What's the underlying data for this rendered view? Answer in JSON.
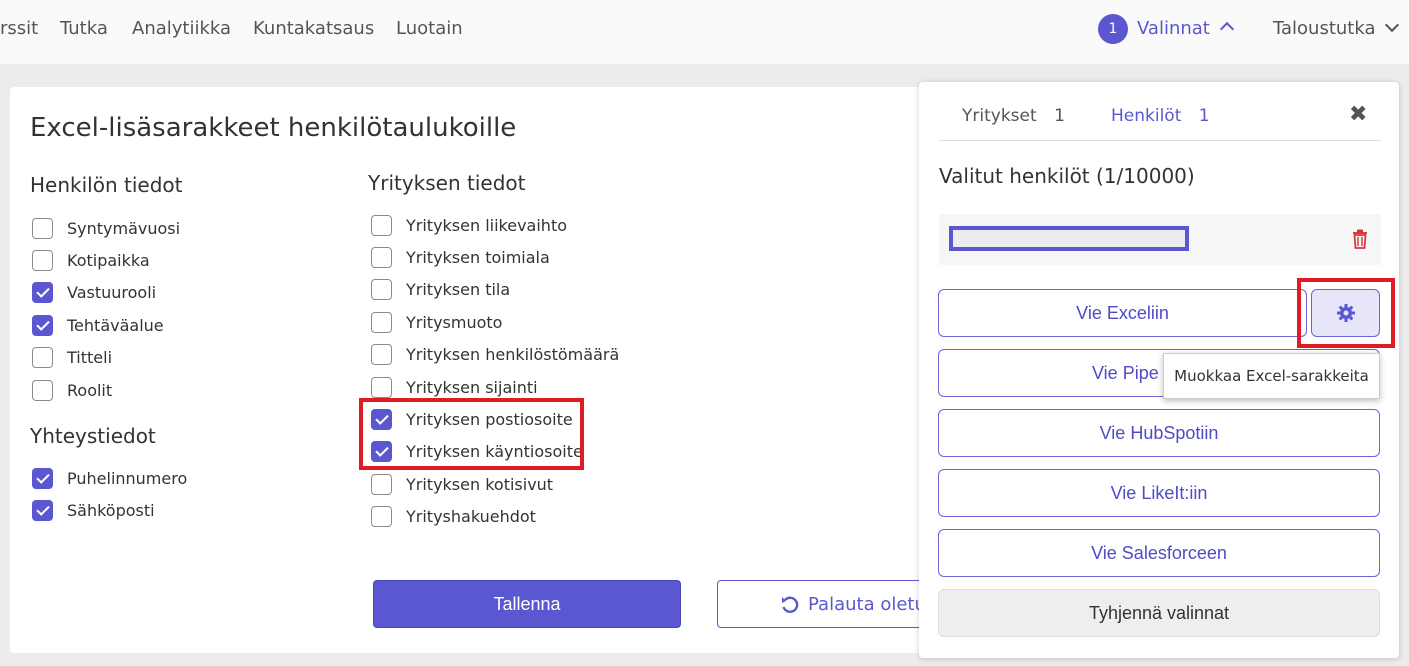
{
  "nav": {
    "items": [
      "rssit",
      "Tutka",
      "Analytiikka",
      "Kuntakatsaus",
      "Luotain"
    ],
    "badge_count": "1",
    "valinnat_label": "Valinnat",
    "taloustutka_label": "Taloustutka"
  },
  "main": {
    "title": "Excel-lisäsarakkeet henkilötaulukoille",
    "person_section": {
      "heading": "Henkilön tiedot",
      "items": [
        {
          "label": "Syntymävuosi",
          "checked": false
        },
        {
          "label": "Kotipaikka",
          "checked": false
        },
        {
          "label": "Vastuurooli",
          "checked": true
        },
        {
          "label": "Tehtäväalue",
          "checked": true
        },
        {
          "label": "Titteli",
          "checked": false
        },
        {
          "label": "Roolit",
          "checked": false
        }
      ]
    },
    "contact_section": {
      "heading": "Yhteystiedot",
      "items": [
        {
          "label": "Puhelinnumero",
          "checked": true
        },
        {
          "label": "Sähköposti",
          "checked": true
        }
      ]
    },
    "company_section": {
      "heading": "Yrityksen tiedot",
      "items": [
        {
          "label": "Yrityksen liikevaihto",
          "checked": false
        },
        {
          "label": "Yrityksen toimiala",
          "checked": false
        },
        {
          "label": "Yrityksen tila",
          "checked": false
        },
        {
          "label": "Yritysmuoto",
          "checked": false
        },
        {
          "label": "Yrityksen henkilöstömäärä",
          "checked": false
        },
        {
          "label": "Yrityksen sijainti",
          "checked": false
        },
        {
          "label": "Yrityksen postiosoite",
          "checked": true
        },
        {
          "label": "Yrityksen käyntiosoite",
          "checked": true
        },
        {
          "label": "Yrityksen kotisivut",
          "checked": false
        },
        {
          "label": "Yrityshakuehdot",
          "checked": false
        }
      ]
    },
    "save_label": "Tallenna",
    "reset_label": "Palauta oletu"
  },
  "panel": {
    "tab_companies_label": "Yritykset",
    "tab_companies_count": "1",
    "tab_persons_label": "Henkilöt",
    "tab_persons_count": "1",
    "subtitle": "Valitut henkilöt (1/10000)",
    "export_excel": "Vie Exceliin",
    "export_pipedrive": "Vie Pipe",
    "export_hubspot": "Vie HubSpotiin",
    "export_likeit": "Vie LikeIt:iin",
    "export_salesforce": "Vie Salesforceen",
    "clear": "Tyhjennä valinnat",
    "tooltip": "Muokkaa Excel-sarakkeita"
  },
  "colors": {
    "accent": "#5b57d1",
    "highlight": "#e01b24",
    "delete": "#d9363e"
  },
  "icons": [
    "chevron-up-icon",
    "chevron-down-icon",
    "close-icon",
    "trash-icon",
    "gear-icon",
    "undo-icon",
    "check-icon"
  ]
}
